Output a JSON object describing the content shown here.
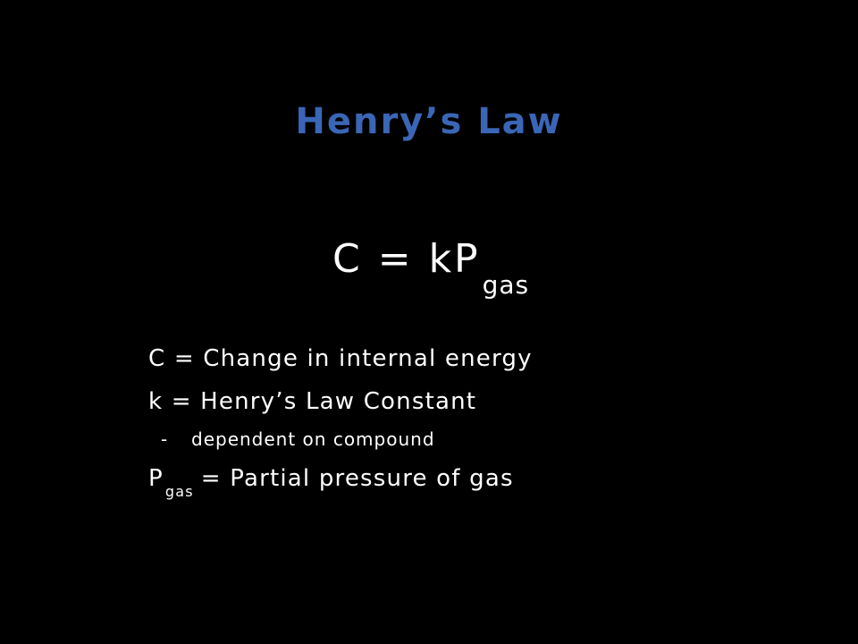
{
  "slide": {
    "title": "Henry’s Law",
    "formula": {
      "main": "C = kP",
      "subscript": "gas"
    },
    "definitions": {
      "c": "C = Change in internal energy",
      "k": "k = Henry’s Law Constant",
      "note_bullet": "-",
      "note_text": "dependent on compound",
      "p_symbol": "P",
      "p_subscript": "gas",
      "p_text": "= Partial pressure of gas"
    }
  },
  "colors": {
    "background": "#000000",
    "title": "#3a66b6",
    "text": "#ffffff"
  }
}
